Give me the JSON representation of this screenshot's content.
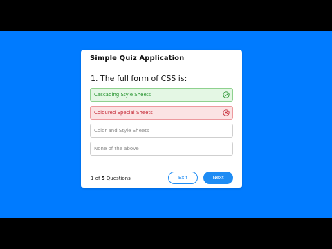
{
  "colors": {
    "background": "#007bff",
    "card": "#ffffff",
    "correct": "#1f8f28",
    "incorrect": "#c42734",
    "accent": "#1e8cf4"
  },
  "app": {
    "title": "Simple Quiz Application"
  },
  "question": {
    "text": "1. The full form of CSS is:"
  },
  "options": [
    {
      "label": "Cascading Style Sheets",
      "state": "correct",
      "icon": "check-circle-icon"
    },
    {
      "label": "Coloured Special Sheets",
      "state": "incorrect",
      "icon": "x-circle-icon"
    },
    {
      "label": "Color and Style Sheets",
      "state": "default"
    },
    {
      "label": "None of the above",
      "state": "default"
    }
  ],
  "footer": {
    "counter_current": "1",
    "counter_of": "of",
    "counter_total": "5",
    "counter_suffix": "Questions",
    "exit_label": "Exit",
    "next_label": "Next"
  }
}
